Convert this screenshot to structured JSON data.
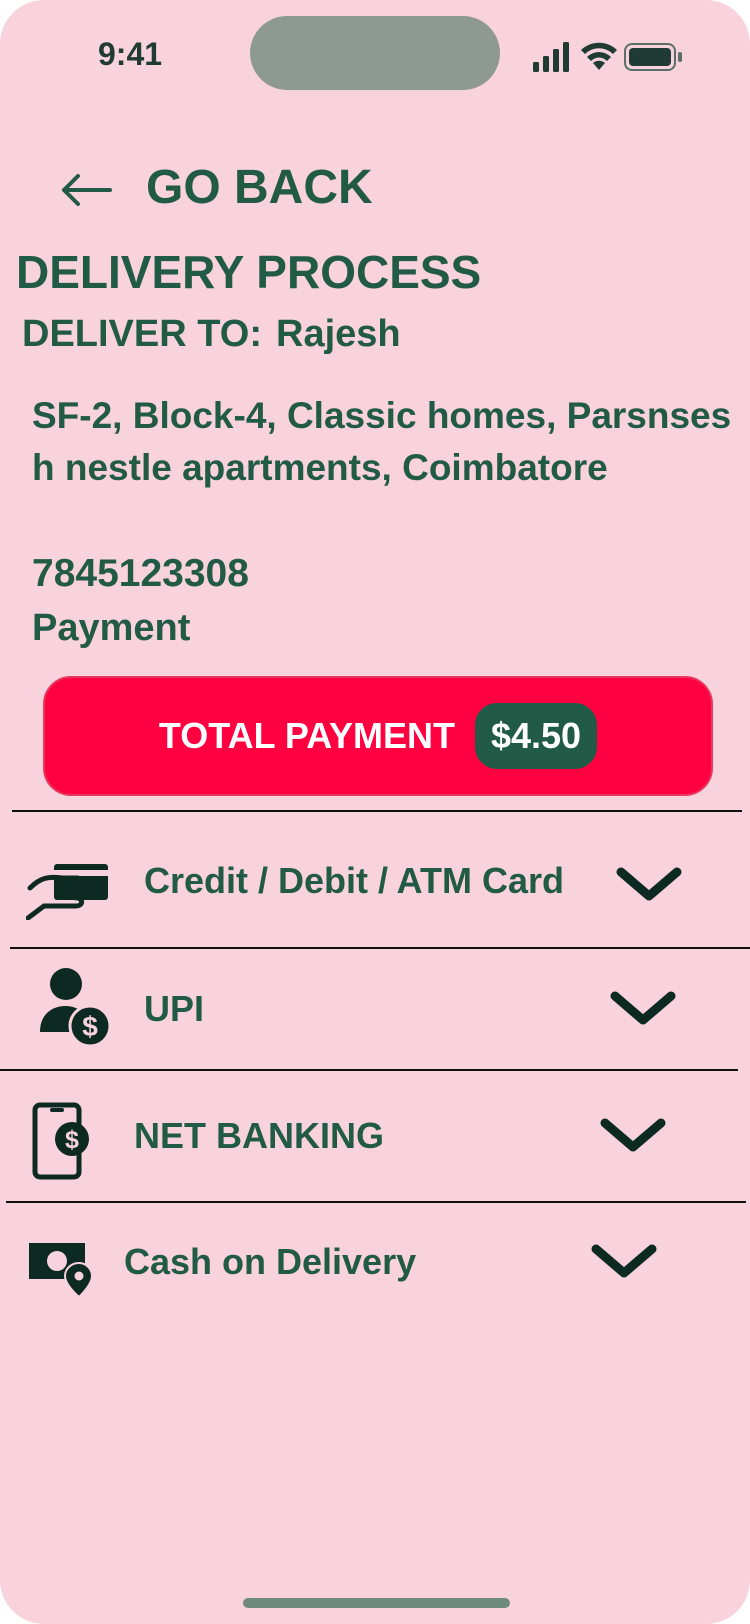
{
  "status_bar": {
    "time": "9:41"
  },
  "nav": {
    "back_label": "GO BACK"
  },
  "page": {
    "title": "DELIVERY PROCESS",
    "deliver_to_label": "DELIVER TO:",
    "recipient_name": "Rajesh",
    "address": "SF-2, Block-4, Classic homes, Parsnsesh nestle apartments, Coimbatore",
    "phone": "7845123308",
    "payment_label": "Payment"
  },
  "total_payment": {
    "label": "TOTAL PAYMENT",
    "amount": "$4.50"
  },
  "payment_methods": [
    {
      "label": "Credit / Debit / ATM Card",
      "icon": "card-in-hand-icon"
    },
    {
      "label": "UPI",
      "icon": "user-dollar-icon"
    },
    {
      "label": "NET BANKING",
      "icon": "phone-dollar-icon"
    },
    {
      "label": "Cash on Delivery",
      "icon": "cash-location-icon"
    }
  ],
  "colors": {
    "background": "#f8d2dc",
    "text": "#225a48",
    "accent": "#ff0040",
    "badge": "#225a48"
  }
}
